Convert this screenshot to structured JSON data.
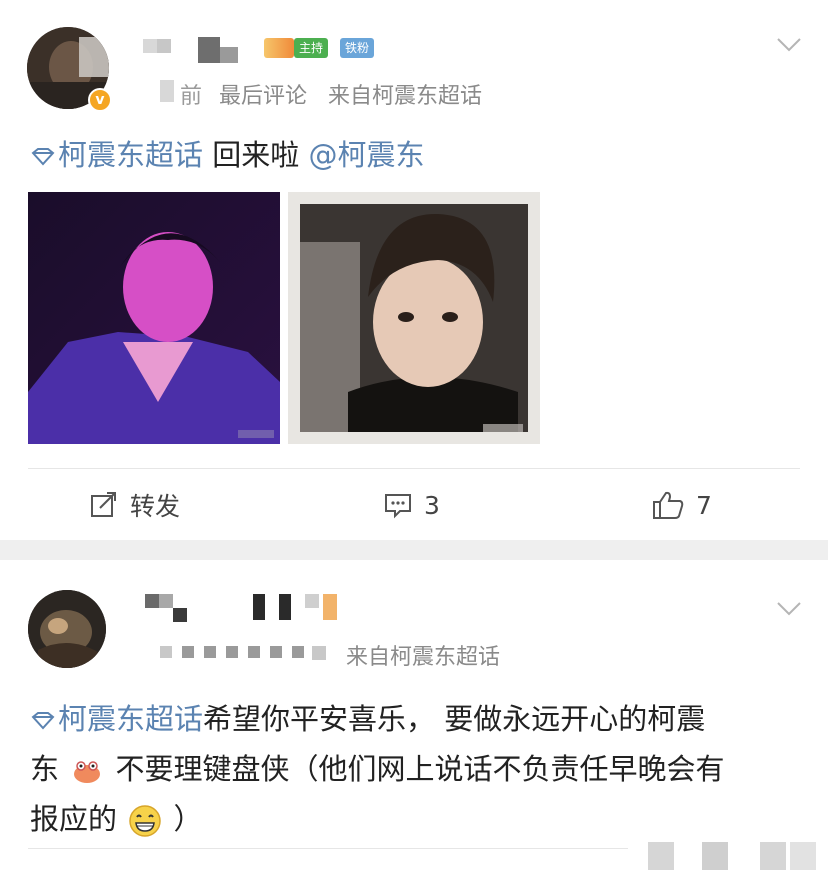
{
  "post1": {
    "badge_host": "主持",
    "badge_fan": "铁粉",
    "meta_time": "前",
    "meta_last_comment": "最后评论",
    "meta_source": "来自柯震东超话",
    "topic": "柯震东超话",
    "text": " 回来啦 ",
    "mention": "@柯震东",
    "actions": {
      "repost_label": "转发",
      "comment_count": "3",
      "like_count": "7"
    }
  },
  "post2": {
    "meta_source": "来自柯震东超话",
    "topic": "柯震东超话",
    "text_line1": "希望你平安喜乐， 要做永远开心的柯震",
    "text_line2_a": "东",
    "text_line2_b": "不要理键盘侠（他们网上说话不负责任早晚会有",
    "text_line3_a": "报应的",
    "text_line3_b": "）"
  },
  "icons": {
    "verified": "verified-v-icon",
    "chevron": "chevron-down-icon",
    "repost": "repost-icon",
    "comment": "comment-icon",
    "like": "thumbs-up-icon",
    "topic": "diamond-topic-icon"
  },
  "colors": {
    "link": "#5b83b1",
    "host_badge": "#4caf50",
    "fan_badge": "#6aa5d9",
    "verified": "#f5a623"
  }
}
